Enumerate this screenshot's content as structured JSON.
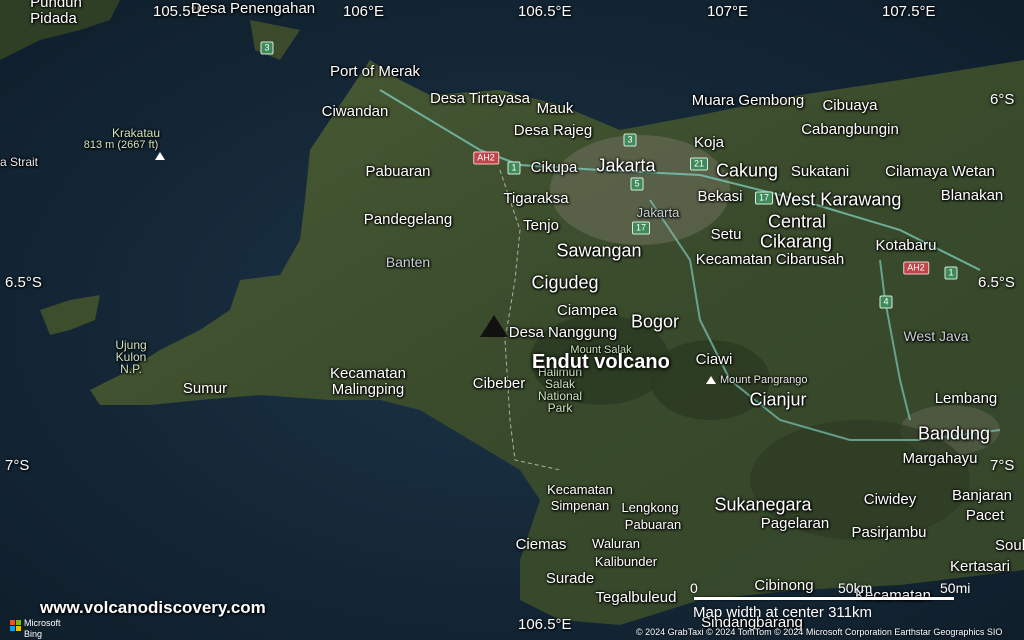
{
  "map": {
    "title": "Endut volcano",
    "website": "www.volcanodiscovery.com",
    "provider": {
      "line1": "Microsoft",
      "line2": "Bing"
    },
    "scale": {
      "zero": "0",
      "km": "50km",
      "mi": "50mi",
      "width_text": "Map width at center 311km"
    },
    "attribution": "© 2024 GrabTaxi © 2024 TomTom © 2024 Microsoft Corporation Earthstar Geographics SIO",
    "coords_top": [
      "105.5°E",
      "106°E",
      "106.5°E",
      "107°E",
      "107.5°E"
    ],
    "coord_bottom": "106.5°E",
    "coords_left": [
      "6.5°S",
      "7°S"
    ],
    "coords_right": [
      "6°S",
      "6.5°S",
      "7°S"
    ],
    "strait": "a Strait",
    "krakatau": {
      "name": "Krakatau",
      "elev": "813 m (2667 ft)"
    },
    "peaks": {
      "salak": "Mount Salak",
      "pangrango": "Mount Pangrango"
    },
    "park": "Halimun\nSalak\nNational\nPark",
    "ujung_kulon": "Ujung\nKulon\nN.P.",
    "regions": {
      "banten": "Banten",
      "west_java": "West Java",
      "jakarta_district": "Jakarta"
    },
    "places": {
      "punduh": "Punduh\nPidada",
      "penengahan": "Desa Penengahan",
      "merak": "Port of Merak",
      "ciwandan": "Ciwandan",
      "tirtayasa": "Desa Tirtayasa",
      "mauk": "Mauk",
      "rajeg": "Desa Rajeg",
      "muara": "Muara Gembong",
      "cibuaya": "Cibuaya",
      "cabang": "Cabangbungin",
      "koja": "Koja",
      "jakarta": "Jakarta",
      "cakung": "Cakung",
      "sukatani": "Sukatani",
      "cilamaya": "Cilamaya Wetan",
      "pabuaran_n": "Pabuaran",
      "cikupa": "Cikupa",
      "tigaraksa": "Tigaraksa",
      "bekasi": "Bekasi",
      "westkarawang": "West Karawang",
      "blanakan": "Blanakan",
      "pandeglang": "Pandegelang",
      "tenjo": "Tenjo",
      "central": "Central",
      "cikarang": "Cikarang",
      "setu": "Setu",
      "sawangan": "Sawangan",
      "kotabaru": "Kotabaru",
      "cibarusah": "Kecamatan Cibarusah",
      "cigudeg": "Cigudeg",
      "ciampea": "Ciampea",
      "nanggung": "Desa Nanggung",
      "bogor": "Bogor",
      "ciawi": "Ciawi",
      "sumur": "Sumur",
      "malingping": "Kecamatan\nMalingping",
      "cibeber": "Cibeber",
      "cianjur": "Cianjur",
      "lembang": "Lembang",
      "bandung": "Bandung",
      "margahayu": "Margahayu",
      "simpenan": "Kecamatan\nSimpenan",
      "lengkong": "Lengkong",
      "pabuaran_s": "Pabuaran",
      "sukanegara": "Sukanegara",
      "pagelaran": "Pagelaran",
      "ciwidey": "Ciwidey",
      "banjaran": "Banjaran",
      "pacet": "Pacet",
      "pasirjambu": "Pasirjambu",
      "ciemas": "Ciemas",
      "waluran": "Waluran",
      "kalibunder": "Kalibunder",
      "kertasari": "Kertasari",
      "surade": "Surade",
      "cibinong": "Cibinong",
      "kecamatan_se": "Kecamatan",
      "tegalbuleud": "Tegalbuleud",
      "sindangbarang": "Sindangbarang",
      "soul": "Soul"
    },
    "shields": {
      "s3": "3",
      "s1": "1",
      "s3b": "3",
      "ah2": "AH2",
      "s21": "21",
      "s5": "5",
      "s17": "17",
      "s17b": "17",
      "ah2b": "AH2",
      "s1b": "1",
      "s4": "4"
    },
    "colors": {
      "sea": "#15283a",
      "land": "#3b4d2e",
      "volcano_marker": "#111111"
    }
  }
}
